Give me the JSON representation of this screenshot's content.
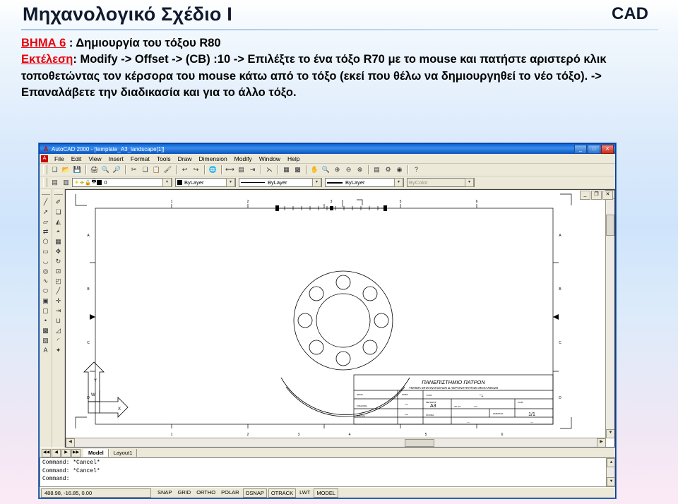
{
  "slide": {
    "title": "Μηχανολογικό Σχέδιο  Ι",
    "title_right": "CAD",
    "step_label": "ΒΗΜΑ 6",
    "step_rest": " : Δημιουργία του τόξου R80",
    "exec_label": "Εκτέλεση",
    "exec_rest": ": Modify -> Offset -> (CB) :10 -> Επιλέξτε το ένα τόξο R70 με το mouse και πατήστε αριστερό κλικ τοποθετώντας τον κέρσορα του mouse κάτω από το τόξο (εκεί που θέλω να δημιουργηθεί το νέο τόξο). -> Επαναλάβετε την διαδικασία και για το άλλο τόξο.",
    "accent_red": "#e8000b",
    "title_color": "#101a2e"
  },
  "acad": {
    "window_title": "AutoCAD 2000 - [template_A3_landscape[1]]",
    "app_icon": "autocad-icon",
    "window_buttons": [
      {
        "name": "minimize",
        "glyph": "_"
      },
      {
        "name": "maximize",
        "glyph": "□"
      },
      {
        "name": "close",
        "glyph": "✕"
      }
    ],
    "mdi_buttons": [
      {
        "name": "mdi-minimize",
        "glyph": "_"
      },
      {
        "name": "mdi-restore",
        "glyph": "❐"
      },
      {
        "name": "mdi-close",
        "glyph": "✕"
      }
    ],
    "menu": [
      "File",
      "Edit",
      "View",
      "Insert",
      "Format",
      "Tools",
      "Draw",
      "Dimension",
      "Modify",
      "Window",
      "Help"
    ],
    "standard_toolbar": [
      {
        "name": "new-icon",
        "glyph": "❑"
      },
      {
        "name": "open-icon",
        "glyph": "📂"
      },
      {
        "name": "save-icon",
        "glyph": "💾"
      },
      {
        "sep": true
      },
      {
        "name": "print-icon",
        "glyph": "🖨"
      },
      {
        "name": "print-preview-icon",
        "glyph": "🔍"
      },
      {
        "name": "find-icon",
        "glyph": "🔎"
      },
      {
        "sep": true
      },
      {
        "name": "cut-icon",
        "glyph": "✂"
      },
      {
        "name": "copy-icon",
        "glyph": "❏"
      },
      {
        "name": "paste-icon",
        "glyph": "📋"
      },
      {
        "name": "match-properties-icon",
        "glyph": "🖌"
      },
      {
        "sep": true
      },
      {
        "name": "undo-icon",
        "glyph": "↩"
      },
      {
        "name": "redo-icon",
        "glyph": "↪"
      },
      {
        "sep": true
      },
      {
        "name": "insert-hyperlink-icon",
        "glyph": "🌐"
      },
      {
        "sep": true
      },
      {
        "name": "distance-icon",
        "glyph": "⟷"
      },
      {
        "name": "block-icon",
        "glyph": "▤"
      },
      {
        "name": "linear-dimension-icon",
        "glyph": "⇥"
      },
      {
        "sep": true
      },
      {
        "name": "snap-from-icon",
        "glyph": "⋋"
      },
      {
        "sep": true
      },
      {
        "name": "design-center-icon",
        "glyph": "▦"
      },
      {
        "name": "properties-icon",
        "glyph": "▩"
      },
      {
        "sep": true
      },
      {
        "name": "pan-realtime-icon",
        "glyph": "✋"
      },
      {
        "name": "zoom-realtime-icon",
        "glyph": "🔍"
      },
      {
        "name": "zoom-window-icon",
        "glyph": "⊕"
      },
      {
        "name": "zoom-previous-icon",
        "glyph": "⊖"
      },
      {
        "name": "zoom-extents-icon",
        "glyph": "⊗"
      },
      {
        "sep": true
      },
      {
        "name": "layout-icon",
        "glyph": "▤"
      },
      {
        "name": "plot-icon",
        "glyph": "⚙"
      },
      {
        "name": "help-context-icon",
        "glyph": "◉"
      },
      {
        "sep": true
      },
      {
        "name": "help-icon",
        "glyph": "?"
      }
    ],
    "properties_toolbar": {
      "layer_buttons": [
        {
          "name": "make-object-layer-current-icon",
          "glyph": "▤"
        },
        {
          "name": "layer-previous-icon",
          "glyph": "▥"
        }
      ],
      "layer_state_icons": [
        {
          "name": "layer-on-icon",
          "glyph": "💡"
        },
        {
          "name": "layer-freeze-icon",
          "glyph": "❄"
        },
        {
          "name": "layer-lock-icon",
          "glyph": "🔓"
        },
        {
          "name": "layer-plot-icon",
          "glyph": "🖨"
        },
        {
          "name": "layer-color-icon",
          "glyph": "■"
        }
      ],
      "layer_value": "0",
      "color_value": "ByLayer",
      "linetype_value": "ByLayer",
      "lineweight_value": "ByLayer",
      "plotstyle_value": "ByColor"
    },
    "draw_toolbar": [
      {
        "name": "line-icon",
        "glyph": "╱"
      },
      {
        "name": "ray-icon",
        "glyph": "➚"
      },
      {
        "name": "polyline-icon",
        "glyph": "▱"
      },
      {
        "name": "multiline-icon",
        "glyph": "⇄"
      },
      {
        "name": "polygon-icon",
        "glyph": "⬡"
      },
      {
        "name": "rectangle-icon",
        "glyph": "▭"
      },
      {
        "name": "arc-icon",
        "glyph": "◡"
      },
      {
        "name": "circle-icon",
        "glyph": "◎"
      },
      {
        "name": "spline-icon",
        "glyph": "∿"
      },
      {
        "name": "ellipse-icon",
        "glyph": "⬭"
      },
      {
        "name": "insert-block-icon",
        "glyph": "▣"
      },
      {
        "name": "make-block-icon",
        "glyph": "▢"
      },
      {
        "name": "point-icon",
        "glyph": "•"
      },
      {
        "name": "hatch-icon",
        "glyph": "▩"
      },
      {
        "name": "region-icon",
        "glyph": "▨"
      },
      {
        "name": "text-icon",
        "glyph": "A"
      }
    ],
    "modify_toolbar": [
      {
        "name": "erase-icon",
        "glyph": "✐"
      },
      {
        "name": "copy-object-icon",
        "glyph": "❏"
      },
      {
        "name": "mirror-icon",
        "glyph": "◭"
      },
      {
        "name": "offset-icon",
        "glyph": "◓"
      },
      {
        "name": "array-icon",
        "glyph": "▦"
      },
      {
        "name": "move-icon",
        "glyph": "✥"
      },
      {
        "name": "rotate-icon",
        "glyph": "↻"
      },
      {
        "name": "scale-icon",
        "glyph": "⊡"
      },
      {
        "name": "stretch-icon",
        "glyph": "◰"
      },
      {
        "name": "lengthen-icon",
        "glyph": "╱"
      },
      {
        "name": "trim-icon",
        "glyph": "✛"
      },
      {
        "name": "extend-icon",
        "glyph": "⇥"
      },
      {
        "name": "break-icon",
        "glyph": "⊔"
      },
      {
        "name": "chamfer-icon",
        "glyph": "◿"
      },
      {
        "name": "fillet-icon",
        "glyph": "◜"
      },
      {
        "name": "explode-icon",
        "glyph": "✦"
      }
    ],
    "layout_tabs": [
      {
        "label": "Model",
        "active": true
      },
      {
        "label": "Layout1",
        "active": false
      }
    ],
    "tab_nav": [
      "◀◀",
      "◀",
      "▶",
      "▶▶"
    ],
    "command_lines": [
      "Command: *Cancel*",
      "Command: *Cancel*",
      "Command:"
    ],
    "status": {
      "coordinates": "488.98, -16.85, 0.00",
      "toggles": [
        "SNAP",
        "GRID",
        "ORTHO",
        "POLAR",
        "OSNAP",
        "OTRACK",
        "LWT",
        "MODEL"
      ]
    }
  },
  "drawing": {
    "title_block": {
      "university": "ΠΑΝΕΠΙΣΤΗΜΙΟ  ΠΑΤΡΩΝ",
      "department": "ΤΜΗΜΑ ΜΗΧΑΝΟΛΟΓΩΝ & ΑΕΡΟΝΑΥΠΗΓΩΝ ΜΗΧΑΝΙΚΩΝ",
      "format_label": "ΜΕΓΕΘΟΣ",
      "format_value": "A3",
      "scale_label": "ΚΛΙΜΑΚΑ",
      "scale_value": "1/1",
      "sheet_label": "ΦΥΛΛΟ",
      "sheet_value": "1/1",
      "dash": "—"
    },
    "frame_marks_top": [
      "1",
      "2",
      "3",
      "4",
      "5",
      "6"
    ],
    "frame_marks_bottom": [
      "1",
      "2",
      "3",
      "4",
      "5",
      "6"
    ],
    "frame_marks_left": [
      "A",
      "B",
      "C",
      "D"
    ],
    "frame_marks_right": [
      "A",
      "B",
      "C",
      "D"
    ],
    "ucs": {
      "x_label": "X",
      "y_label": "Y",
      "w_label": "W"
    },
    "flange": {
      "outer_radius": 58,
      "bolt_circle_radius": 42,
      "inner_radius": 28,
      "bolt_hole_radius": 8,
      "bolt_hole_count": 8,
      "arc_outer_radius": 80,
      "arc_inner_radius": 70
    }
  }
}
